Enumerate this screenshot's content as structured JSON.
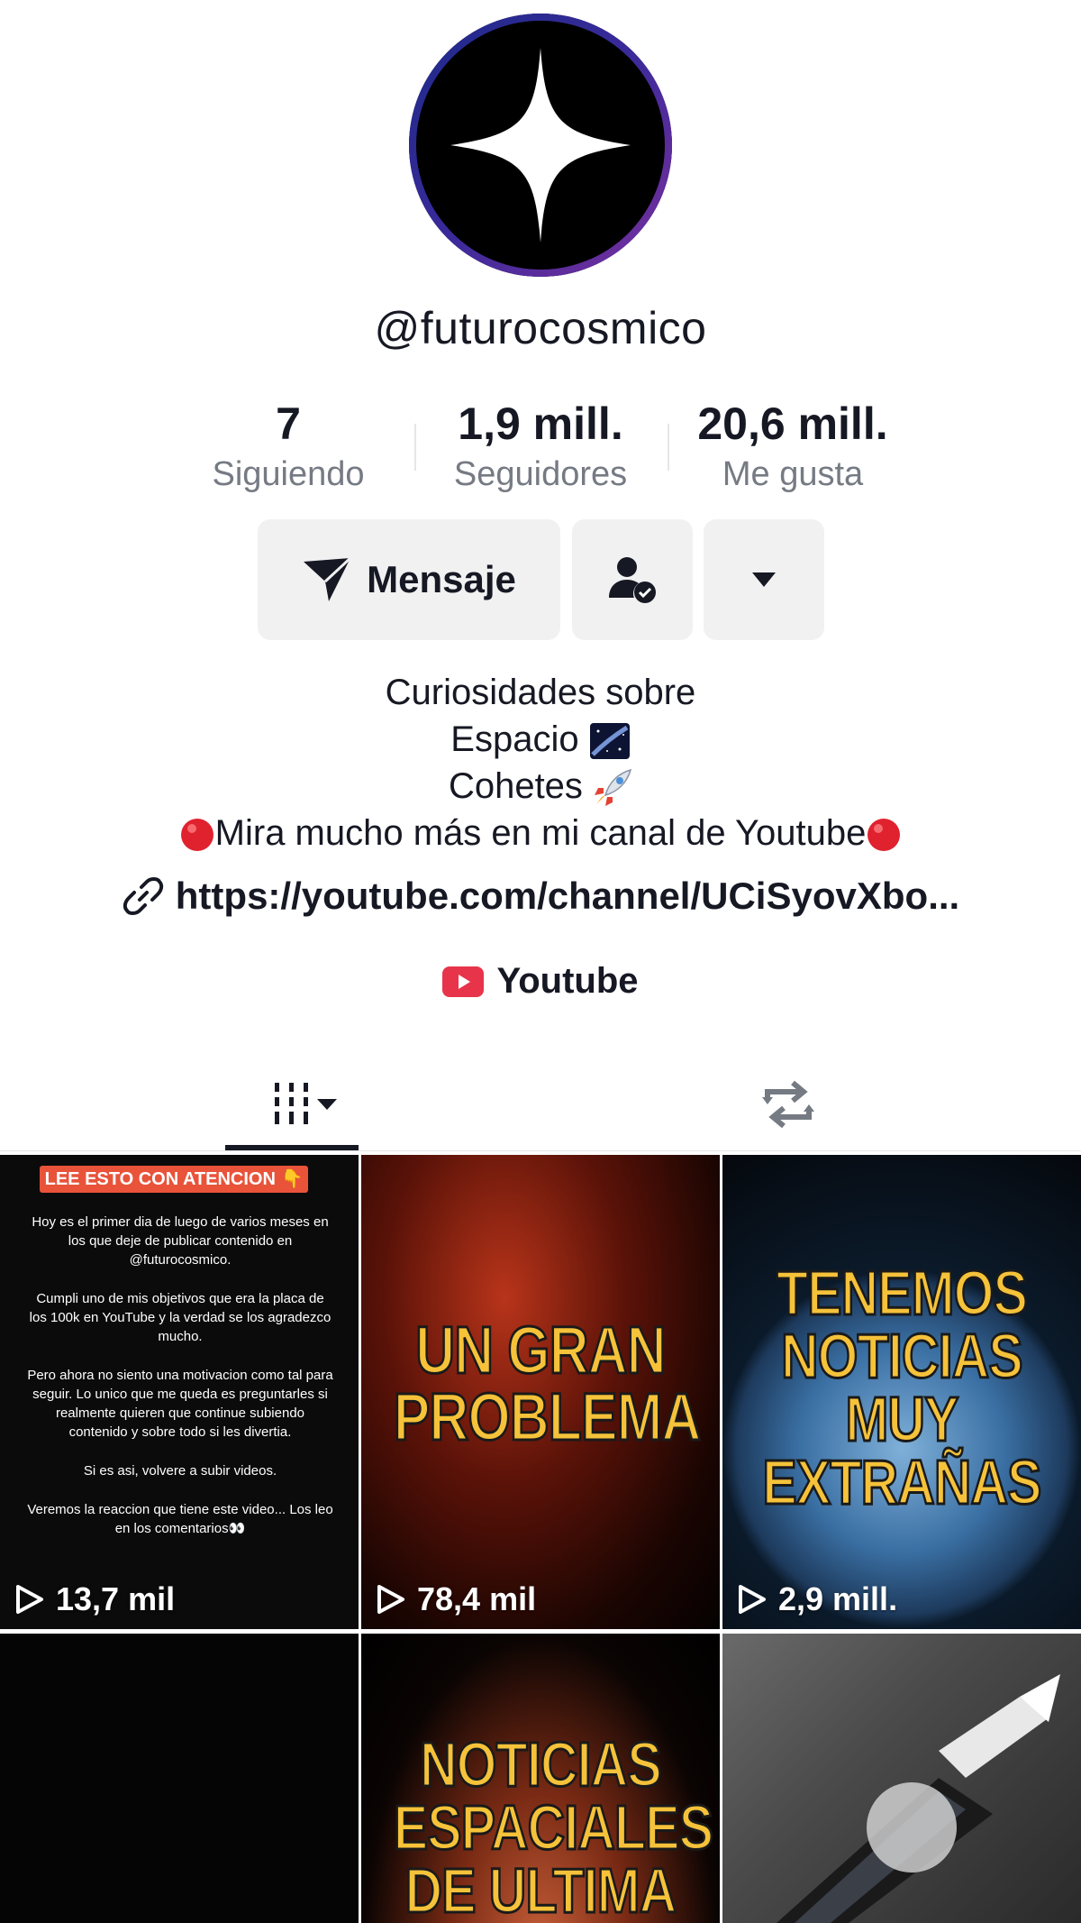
{
  "profile": {
    "username": "@futurocosmico"
  },
  "stats": [
    {
      "value": "7",
      "label": "Siguiendo"
    },
    {
      "value": "1,9 mill.",
      "label": "Seguidores"
    },
    {
      "value": "20,6 mill.",
      "label": "Me gusta"
    }
  ],
  "actions": {
    "message_label": "Mensaje"
  },
  "bio": {
    "line1": "Curiosidades sobre",
    "line2": "Espacio",
    "line3": "Cohetes",
    "line4": "Mira mucho más en mi canal de Youtube"
  },
  "link": {
    "url": "https://youtube.com/channel/UCiSyovXbo..."
  },
  "social": {
    "youtube_label": "Youtube"
  },
  "tabs": [
    "videos-grid",
    "reposts"
  ],
  "videos": [
    {
      "views": "13,7 mil",
      "banner": "LEE ESTO CON ATENCION 👇",
      "paragraphs": [
        "Hoy es el primer dia de luego de varios meses en los que deje de publicar contenido en @futurocosmico.",
        "Cumpli uno de mis objetivos que era la placa de los 100k en YouTube y la verdad se los agradezco mucho.",
        "Pero ahora no siento una motivacion como tal para seguir. Lo unico que me queda es preguntarles si realmente quieren que continue subiendo contenido y sobre todo si les divertia.",
        "Si es asi, volvere a subir videos.",
        "Veremos la reaccion que tiene este video... Los leo en los comentarios👀"
      ]
    },
    {
      "views": "78,4 mil",
      "title_lines": [
        "UN GRAN",
        "PROBLEMA"
      ]
    },
    {
      "views": "2,9 mill.",
      "title_lines": [
        "TENEMOS",
        "NOTICIAS",
        "MUY",
        "EXTRAÑAS"
      ]
    },
    {
      "views": ""
    },
    {
      "views": "",
      "title_lines": [
        "NOTICIAS",
        "ESPACIALES",
        "DE ULTIMA"
      ]
    },
    {
      "views": ""
    }
  ],
  "colors": {
    "text": "#161823",
    "secondary": "#757a83",
    "button_bg": "#f1f1f2",
    "accent_yellow": "#f5c23a",
    "youtube_red": "#e8344a"
  }
}
